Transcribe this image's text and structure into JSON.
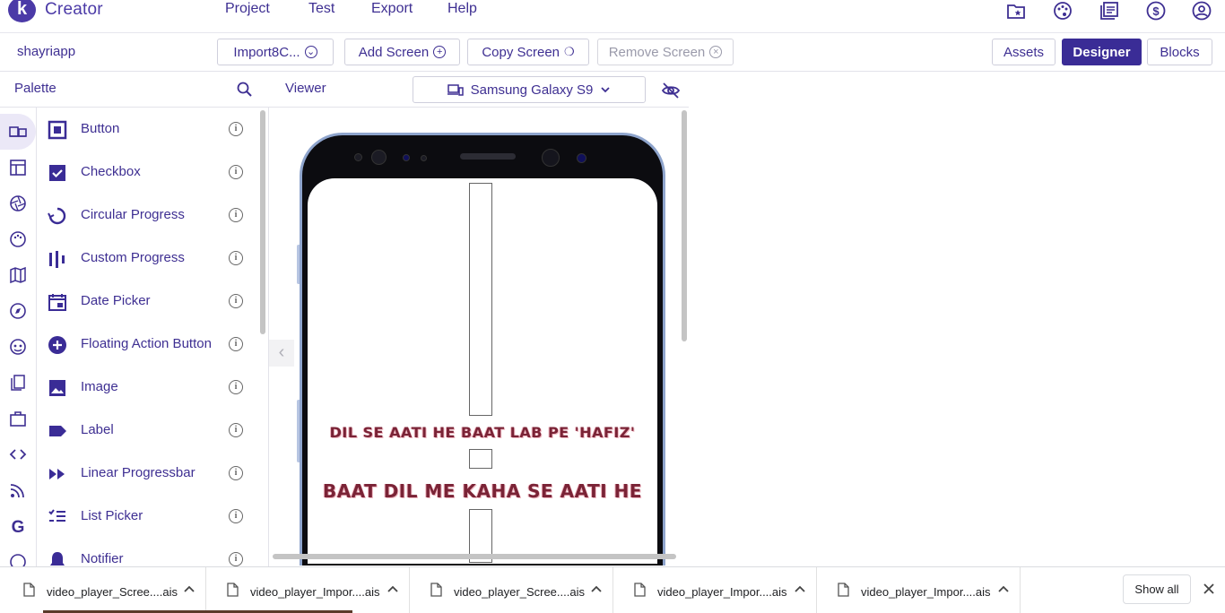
{
  "app": {
    "logo_letter": "k",
    "title": "Creator"
  },
  "menu": [
    "Project",
    "Test",
    "Export",
    "Help"
  ],
  "top_icons": [
    "folder-star-icon",
    "palette-icon",
    "library-icon",
    "dollar-circle-icon",
    "account-circle-icon"
  ],
  "toolbar": {
    "project_name": "shayriapp",
    "screen_select": "Import8C...",
    "add_screen": "Add Screen",
    "copy_screen": "Copy Screen",
    "remove_screen": "Remove Screen",
    "assets": "Assets",
    "designer": "Designer",
    "blocks": "Blocks"
  },
  "palette": {
    "title": "Palette",
    "items": [
      {
        "label": "Button",
        "icon": "button-icon"
      },
      {
        "label": "Checkbox",
        "icon": "checkbox-icon"
      },
      {
        "label": "Circular Progress",
        "icon": "circular-progress-icon"
      },
      {
        "label": "Custom Progress",
        "icon": "custom-progress-icon"
      },
      {
        "label": "Date Picker",
        "icon": "date-picker-icon"
      },
      {
        "label": "Floating Action Button",
        "icon": "floating-action-button-icon"
      },
      {
        "label": "Image",
        "icon": "image-icon"
      },
      {
        "label": "Label",
        "icon": "label-icon"
      },
      {
        "label": "Linear Progressbar",
        "icon": "linear-progressbar-icon"
      },
      {
        "label": "List Picker",
        "icon": "list-picker-icon"
      },
      {
        "label": "Notifier",
        "icon": "notifier-icon"
      }
    ]
  },
  "viewer": {
    "title": "Viewer",
    "device": "Samsung Galaxy S9",
    "screen_text_1": "DIL SE AATI HE BAAT LAB PE 'HAFIZ'",
    "screen_text_2": "BAAT DIL ME KAHA SE AATI HE"
  },
  "downloads": {
    "items": [
      "video_player_Scree....ais",
      "video_player_Impor....ais",
      "video_player_Scree....ais",
      "video_player_Impor....ais",
      "video_player_Impor....ais"
    ],
    "show_all": "Show all"
  },
  "colors": {
    "brand": "#3a2c96",
    "text_accent": "#7a2336"
  }
}
